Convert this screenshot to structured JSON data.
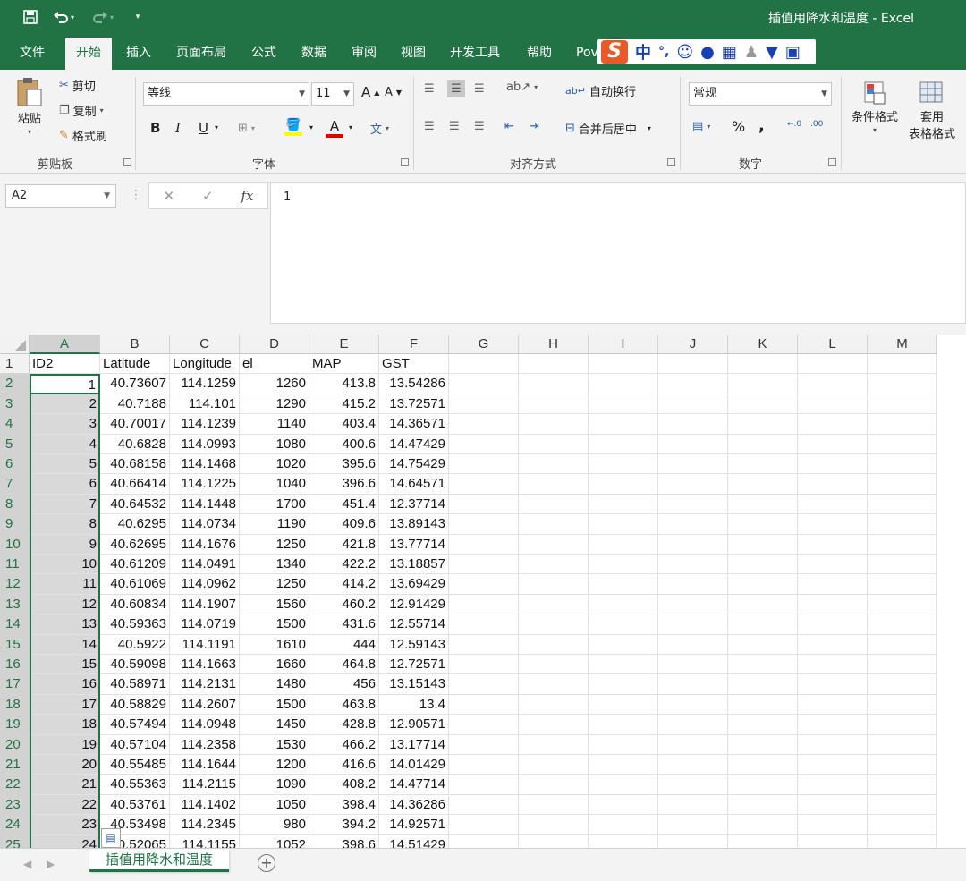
{
  "titlebar": {
    "document_title": "插值用降水和温度  -  Excel",
    "save_icon": "save-icon",
    "undo_icon": "undo-icon",
    "redo_icon": "redo-icon"
  },
  "menu": {
    "tabs": [
      "文件",
      "开始",
      "插入",
      "页面布局",
      "公式",
      "数据",
      "审阅",
      "视图",
      "开发工具",
      "帮助",
      "Pov"
    ],
    "active_tab": "开始"
  },
  "ime_toolbar": {
    "mode": "中",
    "punct": "°,"
  },
  "ribbon": {
    "clipboard": {
      "paste": "粘贴",
      "cut": "剪切",
      "copy": "复制",
      "format_painter": "格式刷",
      "group_label": "剪贴板"
    },
    "font": {
      "font_name": "等线",
      "font_size": "11",
      "bold": "B",
      "italic": "I",
      "underline": "U",
      "group_label": "字体",
      "grow": "A",
      "shrink": "A",
      "phonetic": "文",
      "font_color_letter": "A"
    },
    "alignment": {
      "wrap_text": "自动换行",
      "merge_center": "合并后居中",
      "group_label": "对齐方式"
    },
    "number": {
      "format": "常规",
      "percent": "%",
      "comma": ",",
      "group_label": "数字"
    },
    "styles": {
      "conditional_format": "条件格式",
      "table_format_line1": "套用",
      "table_format_line2": "表格格式"
    }
  },
  "formula_bar": {
    "name_box": "A2",
    "formula": "1",
    "fx": "fx"
  },
  "grid": {
    "columns": [
      "A",
      "B",
      "C",
      "D",
      "E",
      "F",
      "G",
      "H",
      "I",
      "J",
      "K",
      "L",
      "M"
    ],
    "header_row": [
      "ID2",
      "Latitude",
      "Longitude",
      "el",
      "MAP",
      "GST"
    ],
    "rows": [
      [
        "1",
        "40.73607",
        "114.1259",
        "1260",
        "413.8",
        "13.54286"
      ],
      [
        "2",
        "40.7188",
        "114.101",
        "1290",
        "415.2",
        "13.72571"
      ],
      [
        "3",
        "40.70017",
        "114.1239",
        "1140",
        "403.4",
        "14.36571"
      ],
      [
        "4",
        "40.6828",
        "114.0993",
        "1080",
        "400.6",
        "14.47429"
      ],
      [
        "5",
        "40.68158",
        "114.1468",
        "1020",
        "395.6",
        "14.75429"
      ],
      [
        "6",
        "40.66414",
        "114.1225",
        "1040",
        "396.6",
        "14.64571"
      ],
      [
        "7",
        "40.64532",
        "114.1448",
        "1700",
        "451.4",
        "12.37714"
      ],
      [
        "8",
        "40.6295",
        "114.0734",
        "1190",
        "409.6",
        "13.89143"
      ],
      [
        "9",
        "40.62695",
        "114.1676",
        "1250",
        "421.8",
        "13.77714"
      ],
      [
        "10",
        "40.61209",
        "114.0491",
        "1340",
        "422.2",
        "13.18857"
      ],
      [
        "11",
        "40.61069",
        "114.0962",
        "1250",
        "414.2",
        "13.69429"
      ],
      [
        "12",
        "40.60834",
        "114.1907",
        "1560",
        "460.2",
        "12.91429"
      ],
      [
        "13",
        "40.59363",
        "114.0719",
        "1500",
        "431.6",
        "12.55714"
      ],
      [
        "14",
        "40.5922",
        "114.1191",
        "1610",
        "444",
        "12.59143"
      ],
      [
        "15",
        "40.59098",
        "114.1663",
        "1660",
        "464.8",
        "12.72571"
      ],
      [
        "16",
        "40.58971",
        "114.2131",
        "1480",
        "456",
        "13.15143"
      ],
      [
        "17",
        "40.58829",
        "114.2607",
        "1500",
        "463.8",
        "13.4"
      ],
      [
        "18",
        "40.57494",
        "114.0948",
        "1450",
        "428.8",
        "12.90571"
      ],
      [
        "19",
        "40.57104",
        "114.2358",
        "1530",
        "466.2",
        "13.17714"
      ],
      [
        "20",
        "40.55485",
        "114.1644",
        "1200",
        "416.6",
        "14.01429"
      ],
      [
        "21",
        "40.55363",
        "114.2115",
        "1090",
        "408.2",
        "14.47714"
      ],
      [
        "22",
        "40.53761",
        "114.1402",
        "1050",
        "398.4",
        "14.36286"
      ],
      [
        "23",
        "40.53498",
        "114.2345",
        "980",
        "394.2",
        "14.92571"
      ],
      [
        "24",
        "40.52065",
        "114.1155",
        "1052",
        "398.6",
        "14.51429"
      ]
    ]
  },
  "sheets": {
    "tabs": [
      "插值用降水和温度"
    ],
    "add_label": "+"
  },
  "colors": {
    "accent": "#217346",
    "selected_column": "#d9d9d9"
  }
}
